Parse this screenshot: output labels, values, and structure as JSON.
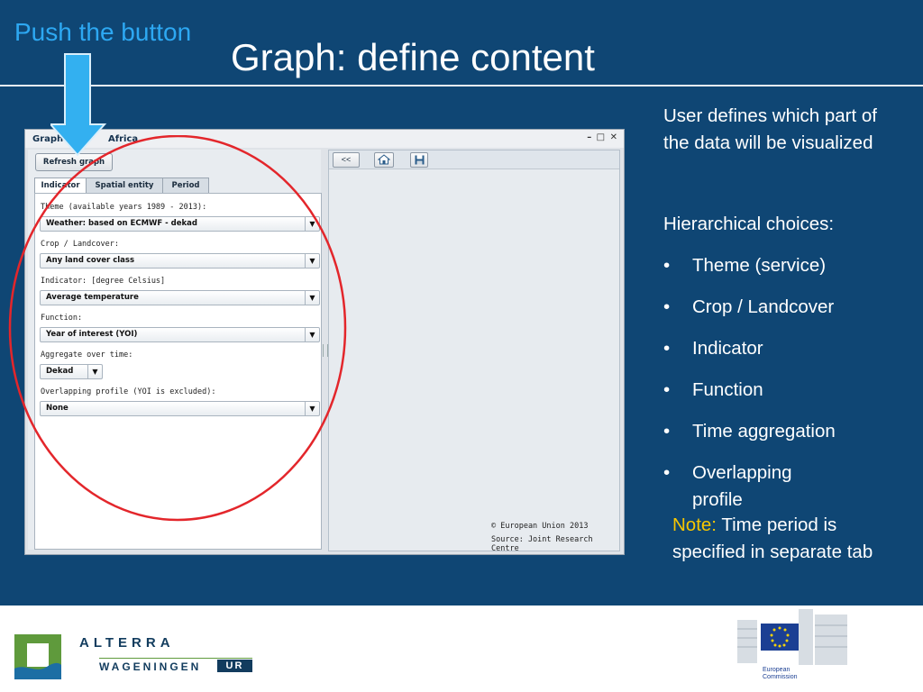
{
  "slide": {
    "push_label": "Push the button",
    "title": "Graph: define content"
  },
  "app": {
    "window_title_left": "Graph",
    "window_title_right": "Africa",
    "window_controls": "– □ ✕",
    "refresh_button": "Refresh graph",
    "tabs": [
      {
        "label": "Indicator",
        "active": true
      },
      {
        "label": "Spatial entity",
        "active": false
      },
      {
        "label": "Period",
        "active": false
      }
    ],
    "form": {
      "theme_label": "Theme (available years 1989 - 2013):",
      "theme_value": "Weather: based on ECMWF  - dekad",
      "crop_label": "Crop / Landcover:",
      "crop_value": "Any land cover class",
      "indicator_label": "Indicator:   [degree Celsius]",
      "indicator_value": "Average temperature",
      "function_label": "Function:",
      "function_value": "Year of interest (YOI)",
      "aggregate_label": "Aggregate over time:",
      "aggregate_value": "Dekad",
      "overlap_label": "Overlapping profile (YOI is excluded):",
      "overlap_value": "None"
    },
    "right_toolbar": {
      "collapse_button": "<<",
      "home_icon": "home-icon",
      "save_icon": "save-icon"
    },
    "copyright_line1": "© European Union 2013",
    "copyright_line2": "Source: Joint Research Centre"
  },
  "description": {
    "intro": "User defines which part of the data will be visualized",
    "hier_heading": "Hierarchical choices:",
    "bullets": [
      "Theme (service)",
      "Crop / Landcover",
      "Indicator",
      "Function",
      "Time aggregation",
      "Overlapping profile"
    ],
    "note_label": "Note:",
    "note_text": " Time period is specified in separate tab"
  },
  "footer": {
    "alterra_text": "ALTERRA",
    "wageningen_text": "WAGENINGEN",
    "ur_text": "UR",
    "ec_line1": "European",
    "ec_line2": "Commission"
  },
  "colors": {
    "slide_bg": "#0f4674",
    "push_label": "#2da8f2",
    "arrow": "#33b0f0",
    "oval": "#e3262b",
    "note": "#f7c600"
  }
}
